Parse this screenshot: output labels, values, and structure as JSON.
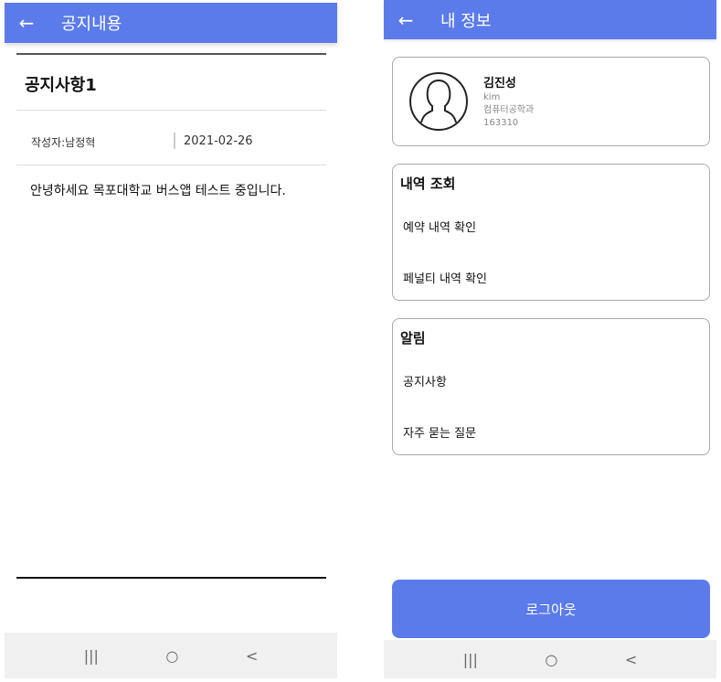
{
  "notice_screen": {
    "title": "공지내용",
    "notice_title": "공지사항1",
    "author": "작성자:남정혁",
    "date": "2021-02-26",
    "body": "안녕하세요 목포대학교 버스앱 테스트 중입니다."
  },
  "profile_screen": {
    "title": "내 정보",
    "user": {
      "name": "김진성",
      "id": "kim",
      "department": "컴퓨터공학과",
      "student_no": "163310"
    },
    "history": {
      "heading": "내역 조회",
      "items": [
        "예약 내역 확인",
        "페널티 내역 확인"
      ]
    },
    "notice": {
      "heading": "알림",
      "items": [
        "공지사항",
        "자주 묻는 질문"
      ]
    },
    "logout_label": "로그아웃"
  },
  "navbar": {
    "recent": "|||",
    "home": "○",
    "back": "<"
  },
  "colors": {
    "primary": "#5b7bea"
  }
}
